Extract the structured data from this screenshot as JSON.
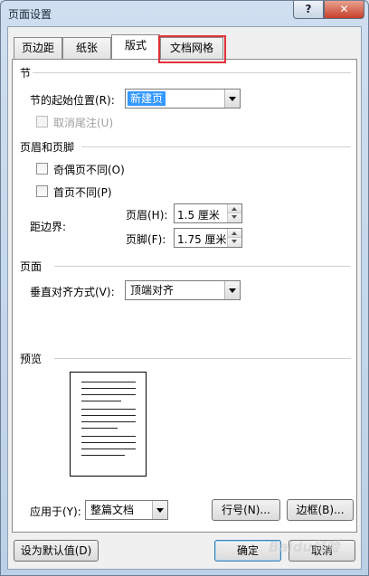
{
  "window": {
    "title": "页面设置",
    "help_label": "?",
    "close_label": "✕"
  },
  "tabs": [
    {
      "label": "页边距",
      "active": false
    },
    {
      "label": "纸张",
      "active": false
    },
    {
      "label": "版式",
      "active": true
    },
    {
      "label": "文档网格",
      "active": false
    }
  ],
  "section_group": {
    "heading": "节",
    "start_label": "节的起始位置(R):",
    "start_value": "新建页",
    "suppress_endnotes_label": "取消尾注(U)"
  },
  "header_footer_group": {
    "heading": "页眉和页脚",
    "odd_even_label": "奇偶页不同(O)",
    "first_page_label": "首页不同(P)",
    "from_edge_label": "距边界:",
    "header_label": "页眉(H):",
    "header_value": "1.5 厘米",
    "footer_label": "页脚(F):",
    "footer_value": "1.75 厘米"
  },
  "page_group": {
    "heading": "页面",
    "vertical_align_label": "垂直对齐方式(V):",
    "vertical_align_value": "顶端对齐"
  },
  "preview_group": {
    "heading": "预览"
  },
  "apply_to": {
    "label": "应用于(Y):",
    "value": "整篇文档"
  },
  "buttons": {
    "line_numbers": "行号(N)...",
    "borders": "边框(B)...",
    "set_default": "设为默认值(D)",
    "ok": "确定",
    "cancel": "取消"
  },
  "watermark_text": "Baidu经验",
  "colors": {
    "highlight": "#e0313b",
    "selection": "#3399ff"
  }
}
